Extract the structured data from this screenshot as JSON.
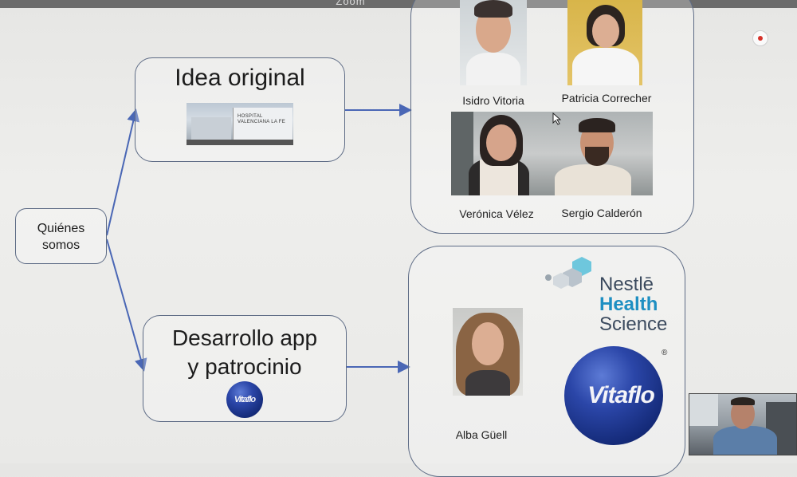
{
  "window": {
    "title": "Zoom"
  },
  "slide": {
    "root": {
      "label_line1": "Quiénes",
      "label_line2": "somos"
    },
    "branch1": {
      "title": "Idea original",
      "people": [
        {
          "name": "Isidro Vitoria"
        },
        {
          "name": "Patricia Correcher"
        },
        {
          "name": "Verónica Vélez"
        },
        {
          "name": "Sergio Calderón"
        }
      ]
    },
    "branch2": {
      "title_line1": "Desarrollo app",
      "title_line2": "y patrocinio",
      "logo_small": "Vitaflo",
      "person": {
        "name": "Alba Güell"
      },
      "sponsor": {
        "line1": "Nestlē",
        "line2": "Health",
        "line3": "Science",
        "brand": "Vitaflo",
        "registered": "®"
      },
      "building_sign": "HOSPITAL VALENCIANA LA FE"
    }
  },
  "colors": {
    "box_border": "#5d6b85",
    "arrow": "#4a67b5",
    "nestle_blue": "#1e8fc2",
    "vitaflo_blue": "#1d3490"
  }
}
